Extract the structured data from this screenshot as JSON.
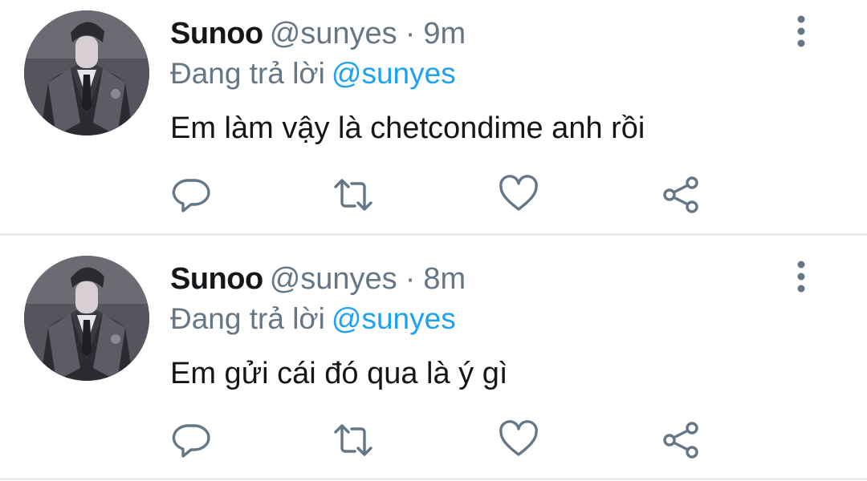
{
  "tweets": [
    {
      "display_name": "Sunoo",
      "handle": "@sunyes",
      "separator": "·",
      "time": "9m",
      "replying_prefix": "Đang trả lời",
      "replying_to": "@sunyes",
      "text": "Em làm vậy là chetcondime anh rồi",
      "icons": {
        "more": "more-vertical-icon",
        "reply": "reply-bubble-icon",
        "retweet": "retweet-icon",
        "like": "heart-icon",
        "share": "share-icon"
      }
    },
    {
      "display_name": "Sunoo",
      "handle": "@sunyes",
      "separator": "·",
      "time": "8m",
      "replying_prefix": "Đang trả lời",
      "replying_to": "@sunyes",
      "text": "Em gửi cái đó qua là ý gì",
      "icons": {
        "more": "more-vertical-icon",
        "reply": "reply-bubble-icon",
        "retweet": "retweet-icon",
        "like": "heart-icon",
        "share": "share-icon"
      }
    }
  ],
  "colors": {
    "text_primary": "#14171a",
    "text_secondary": "#657786",
    "link": "#1da1f2",
    "divider": "#e6ecf0"
  }
}
